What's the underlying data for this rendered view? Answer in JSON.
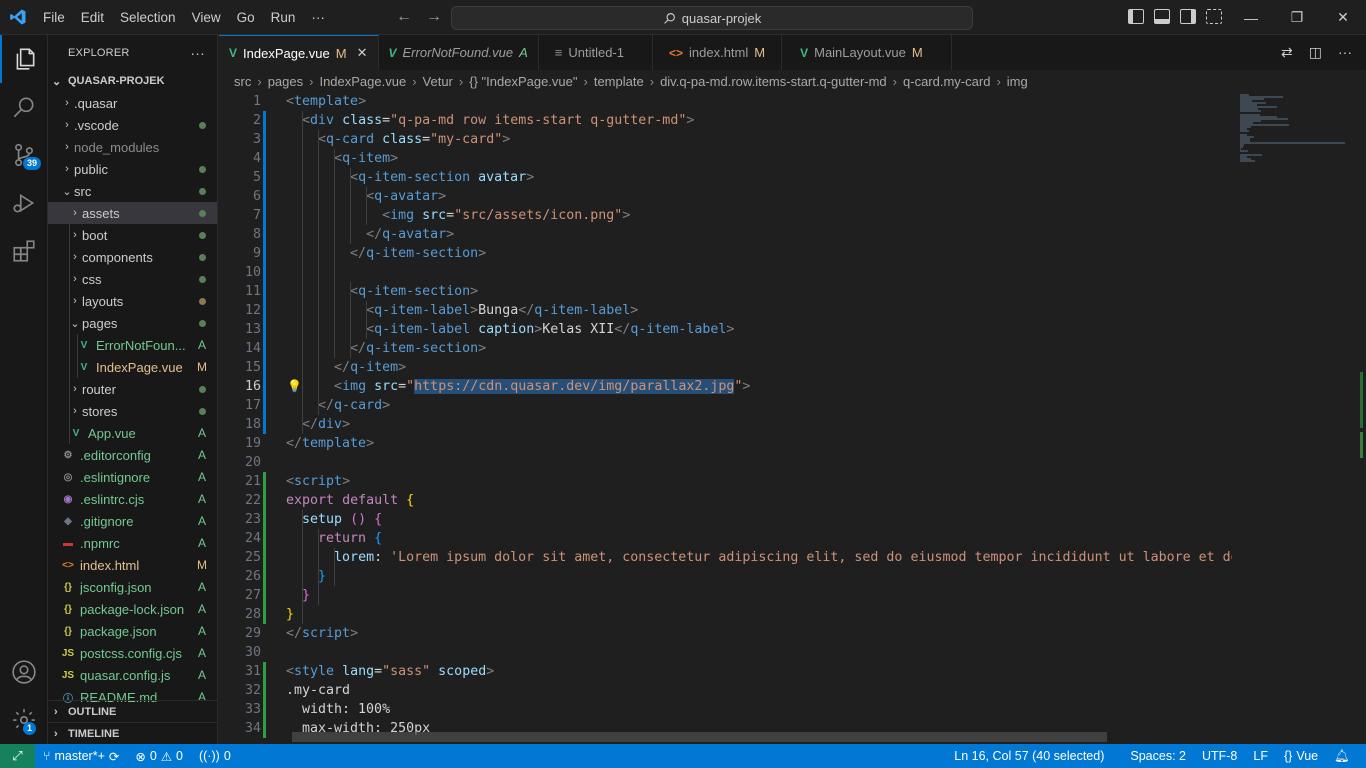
{
  "titlebar": {
    "menu": [
      "File",
      "Edit",
      "Selection",
      "View",
      "Go",
      "Run",
      "···"
    ],
    "command_center": "quasar-projek"
  },
  "activity": {
    "scm_badge": "39",
    "settings_badge": "1"
  },
  "sidebar": {
    "header": "EXPLORER",
    "more": "···",
    "root": "QUASAR-PROJEK",
    "outline": "OUTLINE",
    "timeline": "TIMELINE",
    "items": [
      {
        "label": ".quasar",
        "chev": "›",
        "indent": 1,
        "stat": ""
      },
      {
        "label": ".vscode",
        "chev": "›",
        "indent": 1,
        "stat": "dot"
      },
      {
        "label": "node_modules",
        "chev": "›",
        "indent": 1,
        "stat": "",
        "grey": true
      },
      {
        "label": "public",
        "chev": "›",
        "indent": 1,
        "stat": "dot"
      },
      {
        "label": "src",
        "chev": "⌄",
        "indent": 1,
        "stat": "dot"
      },
      {
        "label": "assets",
        "chev": "›",
        "indent": 2,
        "stat": "dot",
        "selected": true
      },
      {
        "label": "boot",
        "chev": "›",
        "indent": 2,
        "stat": "dot"
      },
      {
        "label": "components",
        "chev": "›",
        "indent": 2,
        "stat": "dot"
      },
      {
        "label": "css",
        "chev": "›",
        "indent": 2,
        "stat": "dot"
      },
      {
        "label": "layouts",
        "chev": "›",
        "indent": 2,
        "stat": "dotb"
      },
      {
        "label": "pages",
        "chev": "⌄",
        "indent": 2,
        "stat": "dot"
      },
      {
        "label": "ErrorNotFoun...",
        "icon": "vue",
        "indent": 3,
        "stat": "A",
        "color": "green"
      },
      {
        "label": "IndexPage.vue",
        "icon": "vue",
        "indent": 3,
        "stat": "M",
        "color": "yellow"
      },
      {
        "label": "router",
        "chev": "›",
        "indent": 2,
        "stat": "dot"
      },
      {
        "label": "stores",
        "chev": "›",
        "indent": 2,
        "stat": "dot"
      },
      {
        "label": "App.vue",
        "icon": "vue",
        "indent": 2,
        "stat": "A",
        "color": "green"
      },
      {
        "label": ".editorconfig",
        "icon": "cfg",
        "indent": 1,
        "stat": "A",
        "color": "green"
      },
      {
        "label": ".eslintignore",
        "icon": "ign",
        "indent": 1,
        "stat": "A",
        "color": "green"
      },
      {
        "label": ".eslintrc.cjs",
        "icon": "esl",
        "indent": 1,
        "stat": "A",
        "color": "green"
      },
      {
        "label": ".gitignore",
        "icon": "git",
        "indent": 1,
        "stat": "A",
        "color": "green"
      },
      {
        "label": ".npmrc",
        "icon": "npm",
        "indent": 1,
        "stat": "A",
        "color": "green"
      },
      {
        "label": "index.html",
        "icon": "html",
        "indent": 1,
        "stat": "M",
        "color": "yellow"
      },
      {
        "label": "jsconfig.json",
        "icon": "json",
        "indent": 1,
        "stat": "A",
        "color": "green"
      },
      {
        "label": "package-lock.json",
        "icon": "json",
        "indent": 1,
        "stat": "A",
        "color": "green"
      },
      {
        "label": "package.json",
        "icon": "json",
        "indent": 1,
        "stat": "A",
        "color": "green"
      },
      {
        "label": "postcss.config.cjs",
        "icon": "js",
        "indent": 1,
        "stat": "A",
        "color": "green"
      },
      {
        "label": "quasar.config.js",
        "icon": "js",
        "indent": 1,
        "stat": "A",
        "color": "green"
      },
      {
        "label": "README.md",
        "icon": "info",
        "indent": 1,
        "stat": "A",
        "color": "green"
      }
    ]
  },
  "tabs": [
    {
      "label": "IndexPage.vue",
      "status": "M",
      "icon": "vue",
      "active": true,
      "close": "✕"
    },
    {
      "label": "ErrorNotFound.vue",
      "status": "A",
      "icon": "vue",
      "italic": true
    },
    {
      "label": "Untitled-1",
      "status": "",
      "icon": "txt"
    },
    {
      "label": "index.html",
      "status": "M",
      "icon": "html"
    },
    {
      "label": "MainLayout.vue",
      "status": "M",
      "icon": "vue"
    }
  ],
  "breadcrumb": [
    "src",
    "pages",
    "IndexPage.vue",
    "Vetur",
    "{} \"IndexPage.vue\"",
    "template",
    "div.q-pa-md.row.items-start.q-gutter-md",
    "q-card.my-card",
    "img"
  ],
  "editor": {
    "current_line": 16,
    "lines": [
      {
        "n": "1",
        "t": [
          [
            "t-br",
            "<"
          ],
          [
            "t-tag",
            "template"
          ],
          [
            "t-br",
            ">"
          ]
        ],
        "g": ""
      },
      {
        "n": "2",
        "t": [
          [
            "t-txt",
            "  "
          ],
          [
            "t-br",
            "<"
          ],
          [
            "t-tag",
            "div"
          ],
          [
            "t-txt",
            " "
          ],
          [
            "t-attr",
            "class"
          ],
          [
            "t-txt",
            "="
          ],
          [
            "t-str",
            "\"q-pa-md row items-start q-gutter-md\""
          ],
          [
            "t-br",
            ">"
          ]
        ],
        "g": "blue"
      },
      {
        "n": "3",
        "t": [
          [
            "t-txt",
            "    "
          ],
          [
            "t-br",
            "<"
          ],
          [
            "t-tag",
            "q-card"
          ],
          [
            "t-txt",
            " "
          ],
          [
            "t-attr",
            "class"
          ],
          [
            "t-txt",
            "="
          ],
          [
            "t-str",
            "\"my-card\""
          ],
          [
            "t-br",
            ">"
          ]
        ],
        "g": "blue"
      },
      {
        "n": "4",
        "t": [
          [
            "t-txt",
            "      "
          ],
          [
            "t-br",
            "<"
          ],
          [
            "t-tag",
            "q-item"
          ],
          [
            "t-br",
            ">"
          ]
        ],
        "g": "blue"
      },
      {
        "n": "5",
        "t": [
          [
            "t-txt",
            "        "
          ],
          [
            "t-br",
            "<"
          ],
          [
            "t-tag",
            "q-item-section"
          ],
          [
            "t-txt",
            " "
          ],
          [
            "t-attr",
            "avatar"
          ],
          [
            "t-br",
            ">"
          ]
        ],
        "g": "blue"
      },
      {
        "n": "6",
        "t": [
          [
            "t-txt",
            "          "
          ],
          [
            "t-br",
            "<"
          ],
          [
            "t-tag",
            "q-avatar"
          ],
          [
            "t-br",
            ">"
          ]
        ],
        "g": "blue"
      },
      {
        "n": "7",
        "t": [
          [
            "t-txt",
            "            "
          ],
          [
            "t-br",
            "<"
          ],
          [
            "t-tag",
            "img"
          ],
          [
            "t-txt",
            " "
          ],
          [
            "t-attr",
            "src"
          ],
          [
            "t-txt",
            "="
          ],
          [
            "t-str",
            "\"src/assets/icon.png\""
          ],
          [
            "t-br",
            ">"
          ]
        ],
        "g": "blue"
      },
      {
        "n": "8",
        "t": [
          [
            "t-txt",
            "          "
          ],
          [
            "t-br",
            "</"
          ],
          [
            "t-tag",
            "q-avatar"
          ],
          [
            "t-br",
            ">"
          ]
        ],
        "g": "blue"
      },
      {
        "n": "9",
        "t": [
          [
            "t-txt",
            "        "
          ],
          [
            "t-br",
            "</"
          ],
          [
            "t-tag",
            "q-item-section"
          ],
          [
            "t-br",
            ">"
          ]
        ],
        "g": "blue"
      },
      {
        "n": "10",
        "t": [],
        "g": "blue"
      },
      {
        "n": "11",
        "t": [
          [
            "t-txt",
            "        "
          ],
          [
            "t-br",
            "<"
          ],
          [
            "t-tag",
            "q-item-section"
          ],
          [
            "t-br",
            ">"
          ]
        ],
        "g": "blue"
      },
      {
        "n": "12",
        "t": [
          [
            "t-txt",
            "          "
          ],
          [
            "t-br",
            "<"
          ],
          [
            "t-tag",
            "q-item-label"
          ],
          [
            "t-br",
            ">"
          ],
          [
            "t-txt",
            "Bunga"
          ],
          [
            "t-br",
            "</"
          ],
          [
            "t-tag",
            "q-item-label"
          ],
          [
            "t-br",
            ">"
          ]
        ],
        "g": "blue"
      },
      {
        "n": "13",
        "t": [
          [
            "t-txt",
            "          "
          ],
          [
            "t-br",
            "<"
          ],
          [
            "t-tag",
            "q-item-label"
          ],
          [
            "t-txt",
            " "
          ],
          [
            "t-attr",
            "caption"
          ],
          [
            "t-br",
            ">"
          ],
          [
            "t-txt",
            "Kelas XII"
          ],
          [
            "t-br",
            "</"
          ],
          [
            "t-tag",
            "q-item-label"
          ],
          [
            "t-br",
            ">"
          ]
        ],
        "g": "blue"
      },
      {
        "n": "14",
        "t": [
          [
            "t-txt",
            "        "
          ],
          [
            "t-br",
            "</"
          ],
          [
            "t-tag",
            "q-item-section"
          ],
          [
            "t-br",
            ">"
          ]
        ],
        "g": "blue"
      },
      {
        "n": "15",
        "t": [
          [
            "t-txt",
            "      "
          ],
          [
            "t-br",
            "</"
          ],
          [
            "t-tag",
            "q-item"
          ],
          [
            "t-br",
            ">"
          ]
        ],
        "g": "blue"
      },
      {
        "n": "16",
        "t": [
          [
            "t-txt",
            "      "
          ],
          [
            "t-br",
            "<"
          ],
          [
            "t-tag",
            "img"
          ],
          [
            "t-txt",
            " "
          ],
          [
            "t-attr",
            "src"
          ],
          [
            "t-txt",
            "="
          ],
          [
            "t-str",
            "\""
          ],
          [
            "t-str sel",
            "https://cdn.quasar.dev/img/parallax2.jpg"
          ],
          [
            "t-str",
            "\""
          ],
          [
            "t-br",
            ">"
          ]
        ],
        "g": "blue",
        "bulb": "💡"
      },
      {
        "n": "17",
        "t": [
          [
            "t-txt",
            "    "
          ],
          [
            "t-br",
            "</"
          ],
          [
            "t-tag",
            "q-card"
          ],
          [
            "t-br",
            ">"
          ]
        ],
        "g": "blue"
      },
      {
        "n": "18",
        "t": [
          [
            "t-txt",
            "  "
          ],
          [
            "t-br",
            "</"
          ],
          [
            "t-tag",
            "div"
          ],
          [
            "t-br",
            ">"
          ]
        ],
        "g": "blue"
      },
      {
        "n": "19",
        "t": [
          [
            "t-br",
            "</"
          ],
          [
            "t-tag",
            "template"
          ],
          [
            "t-br",
            ">"
          ]
        ],
        "g": ""
      },
      {
        "n": "20",
        "t": [],
        "g": ""
      },
      {
        "n": "21",
        "t": [
          [
            "t-br",
            "<"
          ],
          [
            "t-tag",
            "script"
          ],
          [
            "t-br",
            ">"
          ]
        ],
        "g": "green"
      },
      {
        "n": "22",
        "t": [
          [
            "t-kw",
            "export"
          ],
          [
            "t-txt",
            " "
          ],
          [
            "t-kw",
            "default"
          ],
          [
            "t-txt",
            " "
          ],
          [
            "t-pun",
            "{"
          ]
        ],
        "g": "green"
      },
      {
        "n": "23",
        "t": [
          [
            "t-txt",
            "  "
          ],
          [
            "t-key",
            "setup"
          ],
          [
            "t-txt",
            " "
          ],
          [
            "t-pn2",
            "()"
          ],
          [
            "t-txt",
            " "
          ],
          [
            "t-pn2",
            "{"
          ]
        ],
        "g": "green"
      },
      {
        "n": "24",
        "t": [
          [
            "t-txt",
            "    "
          ],
          [
            "t-kw",
            "return"
          ],
          [
            "t-txt",
            " "
          ],
          [
            "t-pn3",
            "{"
          ]
        ],
        "g": "green"
      },
      {
        "n": "25",
        "t": [
          [
            "t-txt",
            "      "
          ],
          [
            "t-key",
            "lorem"
          ],
          [
            "t-txt",
            ": "
          ],
          [
            "t-str",
            "'Lorem ipsum dolor sit amet, consectetur adipiscing elit, sed do eiusmod tempor incididunt ut labore et dolore"
          ]
        ],
        "g": "green"
      },
      {
        "n": "26",
        "t": [
          [
            "t-txt",
            "    "
          ],
          [
            "t-pn3",
            "}"
          ]
        ],
        "g": "green"
      },
      {
        "n": "27",
        "t": [
          [
            "t-txt",
            "  "
          ],
          [
            "t-pn2",
            "}"
          ]
        ],
        "g": "green"
      },
      {
        "n": "28",
        "t": [
          [
            "t-pun",
            "}"
          ]
        ],
        "g": "green"
      },
      {
        "n": "29",
        "t": [
          [
            "t-br",
            "</"
          ],
          [
            "t-tag",
            "script"
          ],
          [
            "t-br",
            ">"
          ]
        ],
        "g": ""
      },
      {
        "n": "30",
        "t": [],
        "g": ""
      },
      {
        "n": "31",
        "t": [
          [
            "t-br",
            "<"
          ],
          [
            "t-tag",
            "style"
          ],
          [
            "t-txt",
            " "
          ],
          [
            "t-attr",
            "lang"
          ],
          [
            "t-txt",
            "="
          ],
          [
            "t-str",
            "\"sass\""
          ],
          [
            "t-txt",
            " "
          ],
          [
            "t-attr",
            "scoped"
          ],
          [
            "t-br",
            ">"
          ]
        ],
        "g": "green"
      },
      {
        "n": "32",
        "t": [
          [
            "t-txt",
            ".my-card"
          ]
        ],
        "g": "green"
      },
      {
        "n": "33",
        "t": [
          [
            "t-txt",
            "  width: 100%"
          ]
        ],
        "g": "green"
      },
      {
        "n": "34",
        "t": [
          [
            "t-txt",
            "  max-width: 250px"
          ]
        ],
        "g": "green"
      }
    ]
  },
  "statusbar": {
    "remote": "⤢",
    "branch": "master*+",
    "sync": "⟳",
    "errors": "0",
    "warnings": "0",
    "ports": "0",
    "cursor": "Ln 16, Col 57 (40 selected)",
    "spaces": "Spaces: 2",
    "encoding": "UTF-8",
    "eol": "LF",
    "language": "Vue"
  }
}
